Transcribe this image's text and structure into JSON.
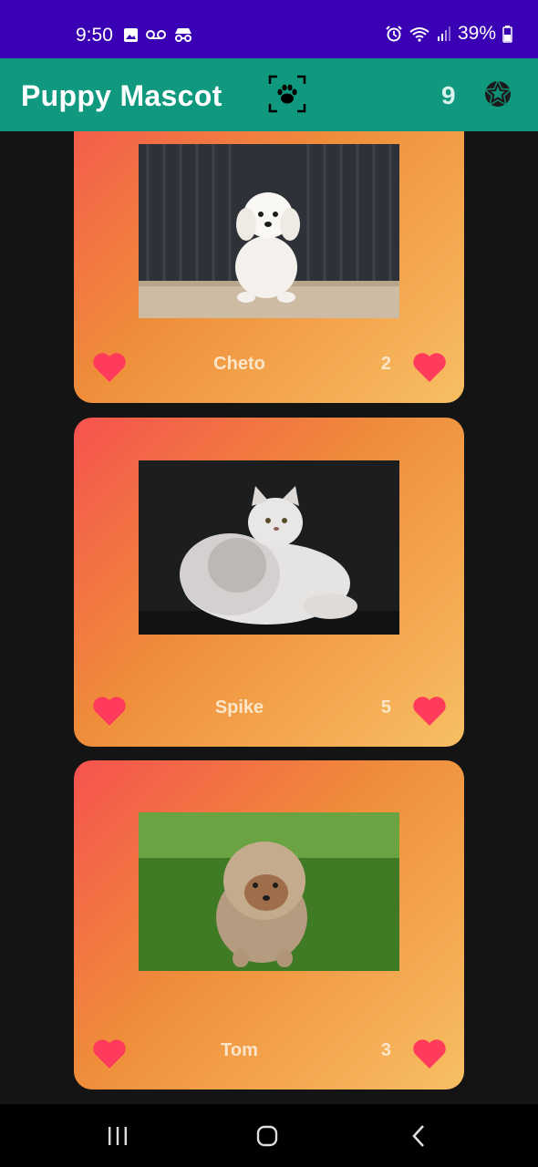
{
  "status_bar": {
    "time": "9:50",
    "battery": "39%"
  },
  "app_bar": {
    "title": "Puppy Mascot",
    "count": "9"
  },
  "cards": [
    {
      "name": "Cheto",
      "likes": "2"
    },
    {
      "name": "Spike",
      "likes": "5"
    },
    {
      "name": "Tom",
      "likes": "3"
    }
  ],
  "colors": {
    "status_bar": "#3a00b4",
    "app_bar": "#10997e",
    "heart": "#ff3b5c",
    "background": "#141414"
  },
  "icons": [
    "image-icon",
    "voicemail-icon",
    "incognito-icon",
    "alarm-icon",
    "wifi-icon",
    "signal-icon",
    "battery-icon",
    "paw-scan-icon",
    "star-badge-icon",
    "heart-icon",
    "recents-icon",
    "home-icon",
    "back-icon"
  ]
}
